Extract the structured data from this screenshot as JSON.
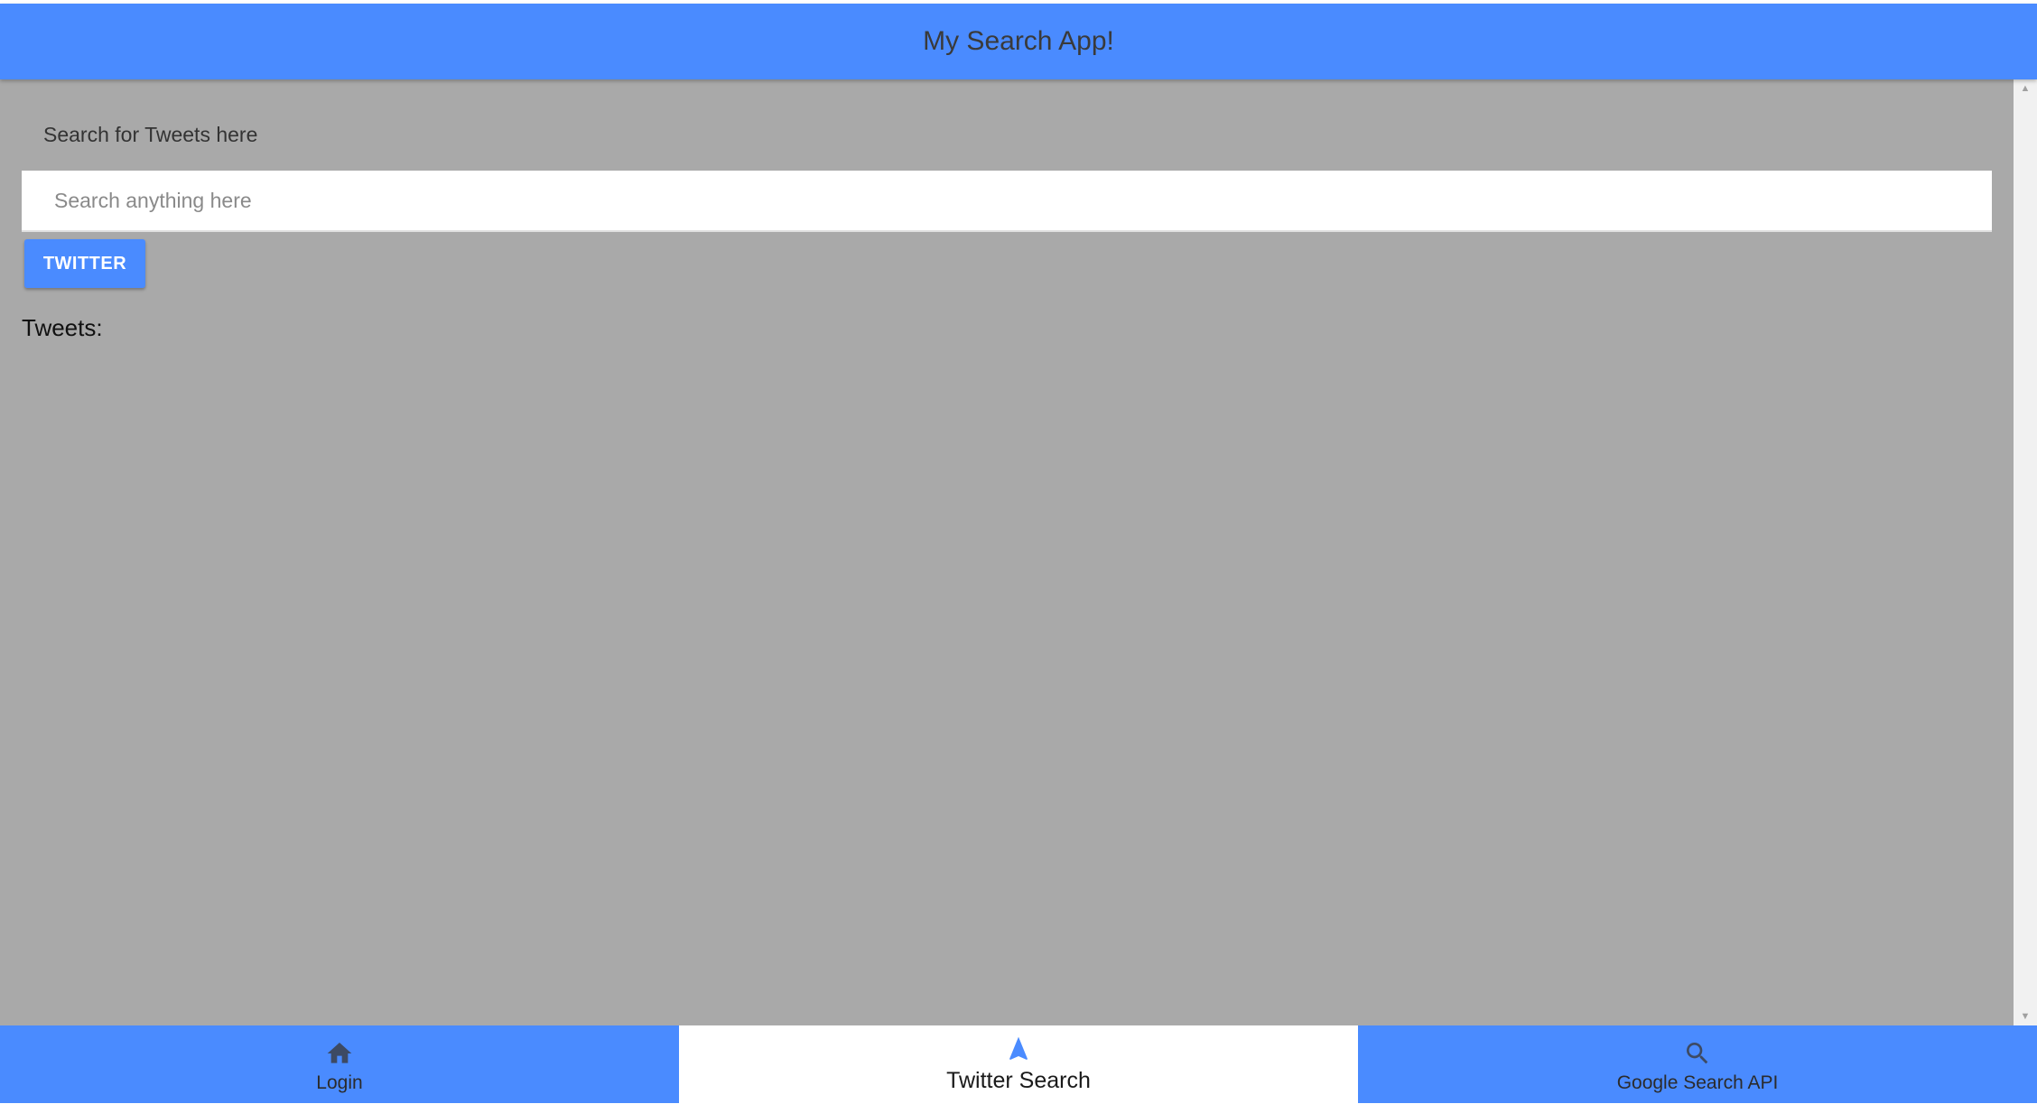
{
  "header": {
    "title": "My Search App!"
  },
  "main": {
    "search_label": "Search for Tweets here",
    "search_placeholder": "Search anything here",
    "search_value": "",
    "twitter_button_label": "TWITTER",
    "tweets_heading": "Tweets:"
  },
  "tabs": [
    {
      "label": "Login",
      "icon": "home-icon",
      "active": false
    },
    {
      "label": "Twitter Search",
      "icon": "navigation-arrow-icon",
      "active": true
    },
    {
      "label": "Google Search API",
      "icon": "search-icon",
      "active": false
    }
  ],
  "colors": {
    "accent": "#4a8bff",
    "content_background": "#a9a9a9",
    "active_tab_background": "#ffffff"
  }
}
